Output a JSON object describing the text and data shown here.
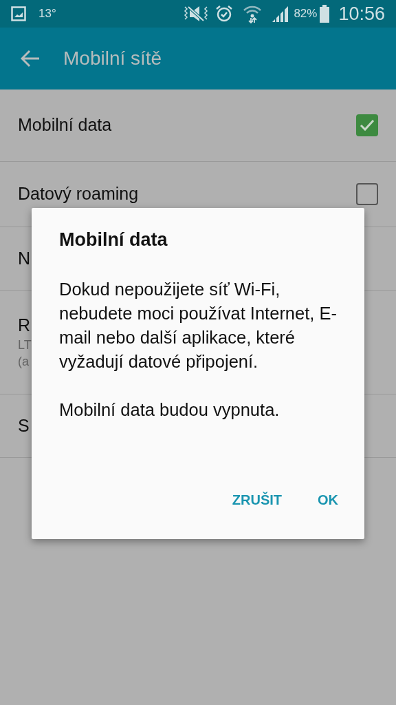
{
  "status_bar": {
    "temperature": "13°",
    "battery": "82%",
    "time": "10:56"
  },
  "app_bar": {
    "title": "Mobilní sítě"
  },
  "settings": [
    {
      "kind": "checkbox",
      "title": "Mobilní data",
      "checked": true
    },
    {
      "kind": "checkbox",
      "title": "Datový roaming",
      "checked": false
    },
    {
      "kind": "plain",
      "title": "N"
    },
    {
      "kind": "summary",
      "title": "R",
      "summary": [
        "LT",
        "(a"
      ]
    },
    {
      "kind": "plain",
      "title": "S"
    }
  ],
  "dialog": {
    "title": "Mobilní data",
    "paragraphs": [
      "Dokud nepoužijete síť Wi-Fi, nebudete moci používat Internet, E-mail nebo další aplikace, které vyžadují datové připojení.",
      "Mobilní data budou vypnuta."
    ],
    "buttons": [
      "ZRUŠIT",
      "OK"
    ]
  }
}
